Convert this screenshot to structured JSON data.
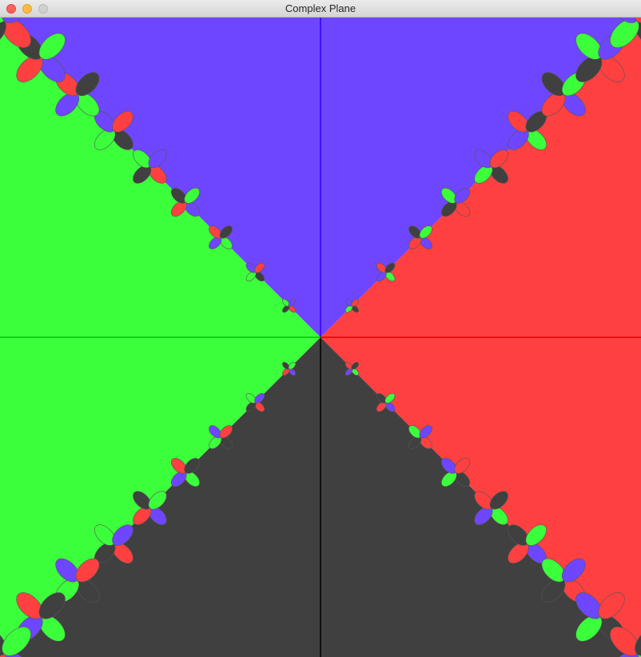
{
  "window": {
    "title": "Complex Plane",
    "controls": {
      "close": "close-button",
      "minimize": "minimize-button",
      "zoom": "zoom-button"
    }
  },
  "colors": {
    "root_top": "#6e46ff",
    "root_right": "#ff4040",
    "root_bottom": "#404040",
    "root_left": "#3cff3c",
    "axis_top": "#3000ff",
    "axis_right": "#e00000",
    "axis_bottom": "#000000",
    "axis_left": "#00c000"
  }
}
